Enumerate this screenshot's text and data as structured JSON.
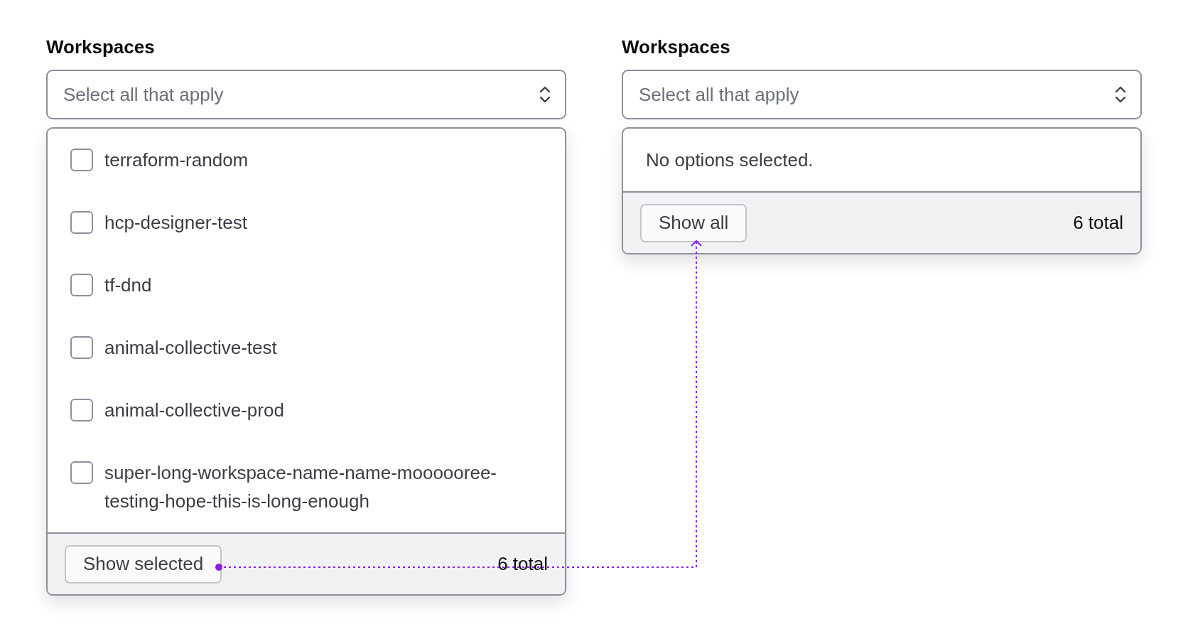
{
  "panels": [
    {
      "label": "Workspaces",
      "select": {
        "placeholder": "Select all that apply"
      },
      "kind": "list",
      "options": [
        {
          "label": "terraform-random",
          "checked": false
        },
        {
          "label": "hcp-designer-test",
          "checked": false
        },
        {
          "label": "tf-dnd",
          "checked": false
        },
        {
          "label": "animal-collective-test",
          "checked": false
        },
        {
          "label": "animal-collective-prod",
          "checked": false
        },
        {
          "label": "super-long-workspace-name-name-moooooree-testing-hope-this-is-long-enough",
          "checked": false
        }
      ],
      "footer": {
        "button": "Show selected",
        "total": "6 total"
      }
    },
    {
      "label": "Workspaces",
      "select": {
        "placeholder": "Select all that apply"
      },
      "kind": "empty",
      "message": "No options selected.",
      "footer": {
        "button": "Show all",
        "total": "6 total"
      }
    }
  ]
}
